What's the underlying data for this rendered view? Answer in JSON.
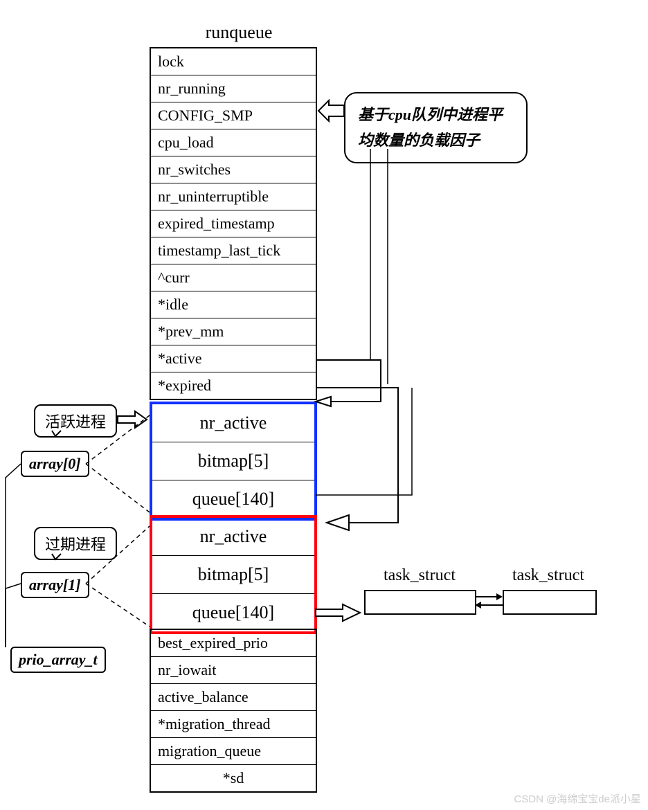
{
  "title": "runqueue",
  "fields_top": [
    "lock",
    "nr_running",
    "CONFIG_SMP",
    "cpu_load",
    "nr_switches",
    "nr_uninterruptible",
    "expired_timestamp",
    "timestamp_last_tick",
    "^curr",
    "*idle",
    "*prev_mm",
    "*active",
    "*expired"
  ],
  "array_active": {
    "fields": [
      "nr_active",
      "bitmap[5]",
      "queue[140]"
    ]
  },
  "array_expired": {
    "fields": [
      "nr_active",
      "bitmap[5]",
      "queue[140]"
    ]
  },
  "fields_bottom": [
    "best_expired_prio",
    "nr_iowait",
    "active_balance",
    "*migration_thread",
    "migration_queue",
    "*sd"
  ],
  "callout_cpu_load": "基于cpu队列中进程平均数量的负载因子",
  "callout_active": "活跃进程",
  "callout_expired": "过期进程",
  "label_array0": "array[0]",
  "label_array1": "array[1]",
  "label_prio": "prio_array_t",
  "task_struct_label": "task_struct",
  "watermark": "CSDN @海绵宝宝de派小星"
}
